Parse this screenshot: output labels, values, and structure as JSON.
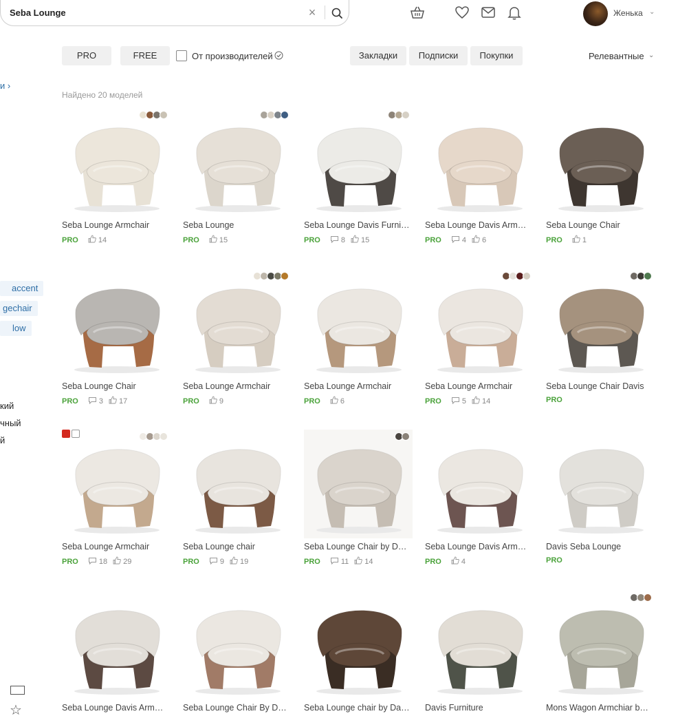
{
  "search": {
    "value": "Seba Lounge"
  },
  "user": {
    "name": "Женька"
  },
  "filters": {
    "pro": "PRO",
    "free": "FREE",
    "from_manufacturers": "От производителей",
    "bookmarks": "Закладки",
    "subscriptions": "Подписки",
    "purchases": "Покупки",
    "sort": "Релевантные"
  },
  "sidebar": {
    "link_fragment": "и",
    "tags": [
      "accent",
      "gechair",
      "low"
    ],
    "text_items": [
      "кий",
      "чный",
      "й"
    ]
  },
  "results_count": "Найдено 20 моделей",
  "colors": {
    "pro_green": "#4aa23a",
    "link_blue": "#2e6ea6"
  },
  "cards": [
    {
      "title": "Seba Lounge Armchair",
      "badge": "PRO",
      "comments": "",
      "likes": "14",
      "chair": "#ece6db",
      "base": "#e8e2d6",
      "bg": "#ffffff",
      "swatches": [
        "#e9e2d2",
        "#8a5a3a",
        "#7b756d",
        "#c9c2b4"
      ]
    },
    {
      "title": "Seba Lounge",
      "badge": "PRO",
      "comments": "",
      "likes": "15",
      "chair": "#e6e0d7",
      "base": "#dcd6cc",
      "bg": "#ffffff",
      "swatches": [
        "#a9a39a",
        "#d8d0c4",
        "#7e848a",
        "#3f5e83"
      ]
    },
    {
      "title": "Seba Lounge Davis Furni…",
      "badge": "PRO",
      "comments": "8",
      "likes": "15",
      "chair": "#ecebe7",
      "base": "#4f4a46",
      "bg": "#ffffff",
      "swatches": [
        "#8d8377",
        "#b5a893",
        "#d6d0c5"
      ]
    },
    {
      "title": "Seba Lounge Davis Arm…",
      "badge": "PRO",
      "comments": "4",
      "likes": "6",
      "chair": "#e6d8ca",
      "base": "#d8c8b8",
      "bg": "#ffffff",
      "swatches": []
    },
    {
      "title": "Seba Lounge Chair",
      "badge": "PRO",
      "comments": "",
      "likes": "1",
      "chair": "#6b5f55",
      "base": "#3e3630",
      "bg": "#ffffff",
      "swatches": []
    },
    {
      "title": "Seba Lounge Chair",
      "badge": "PRO",
      "comments": "3",
      "likes": "17",
      "chair": "#b9b6b2",
      "base": "#a66b45",
      "bg": "#ffffff",
      "swatches": []
    },
    {
      "title": "Seba Lounge Armchair",
      "badge": "PRO",
      "comments": "",
      "likes": "9",
      "chair": "#e3dcd3",
      "base": "#d6cdc1",
      "bg": "#ffffff",
      "swatches": [
        "#e7e1d6",
        "#bdb6aa",
        "#4b4b44",
        "#7b7966",
        "#b57a2a"
      ]
    },
    {
      "title": "Seba Lounge Armchair",
      "badge": "PRO",
      "comments": "",
      "likes": "6",
      "chair": "#ebe7e1",
      "base": "#b5987d",
      "bg": "#ffffff",
      "swatches": []
    },
    {
      "title": "Seba Lounge Armchair",
      "badge": "PRO",
      "comments": "5",
      "likes": "14",
      "chair": "#ebe6e0",
      "base": "#c9ad98",
      "bg": "#ffffff",
      "swatches": [
        "#6b4a3a",
        "#e6e2dc",
        "#5a1e1e",
        "#d6cfc4"
      ]
    },
    {
      "title": "Seba Lounge Chair Davis",
      "badge": "PRO",
      "comments": "",
      "likes": "",
      "chair": "#a5927e",
      "base": "#5d5852",
      "bg": "#ffffff",
      "swatches": [
        "#6f6a63",
        "#3e3b36",
        "#4f7a4f"
      ]
    },
    {
      "title": "Seba Lounge Armchair",
      "badge": "PRO",
      "comments": "18",
      "likes": "29",
      "chair": "#ece8e2",
      "base": "#c3a98e",
      "bg": "#ffffff",
      "swatches": [
        "#efebe5",
        "#a69a8f",
        "#dcd6cd",
        "#e8e4dc"
      ],
      "brand": true
    },
    {
      "title": "Seba Lounge chair",
      "badge": "PRO",
      "comments": "9",
      "likes": "19",
      "chair": "#e8e4de",
      "base": "#7c5a45",
      "bg": "#ffffff",
      "swatches": []
    },
    {
      "title": "Seba Lounge Chair by D…",
      "badge": "PRO",
      "comments": "11",
      "likes": "14",
      "chair": "#dad4cc",
      "base": "#c5bdb3",
      "bg": "#f7f6f4",
      "swatches": [
        "#4a4540",
        "#8a8278"
      ]
    },
    {
      "title": "Seba Lounge Davis Arm…",
      "badge": "PRO",
      "comments": "",
      "likes": "4",
      "chair": "#ebe7e1",
      "base": "#6d5551",
      "bg": "#ffffff",
      "swatches": []
    },
    {
      "title": "Davis Seba Lounge",
      "badge": "PRO",
      "comments": "",
      "likes": "",
      "chair": "#e3e1dc",
      "base": "#cfccc6",
      "bg": "#ffffff",
      "swatches": []
    },
    {
      "title": "Seba Lounge Davis Arm…",
      "badge": "",
      "comments": "",
      "likes": "",
      "chair": "#e2ded8",
      "base": "#5c4a42",
      "bg": "#ffffff",
      "swatches": []
    },
    {
      "title": "Seba Lounge Chair By D…",
      "badge": "",
      "comments": "",
      "likes": "",
      "chair": "#ebe7e1",
      "base": "#a17b67",
      "bg": "#ffffff",
      "swatches": []
    },
    {
      "title": "Seba Lounge chair by Da…",
      "badge": "",
      "comments": "",
      "likes": "",
      "chair": "#5e4738",
      "base": "#3a2d24",
      "bg": "#ffffff",
      "swatches": []
    },
    {
      "title": "Davis Furniture",
      "badge": "",
      "comments": "",
      "likes": "",
      "chair": "#e2ddd5",
      "base": "#4f5349",
      "bg": "#ffffff",
      "swatches": []
    },
    {
      "title": "Mons Wagon Armchiar b…",
      "badge": "",
      "comments": "",
      "likes": "",
      "chair": "#bdbdb0",
      "base": "#a7a699",
      "bg": "#ffffff",
      "swatches": [
        "#6e6a65",
        "#8f8679",
        "#9c6b4a"
      ]
    }
  ]
}
